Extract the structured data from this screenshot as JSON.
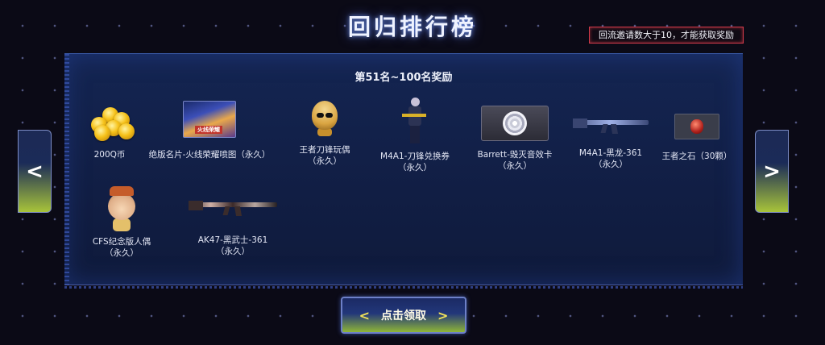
{
  "page": {
    "title": "回归排行榜",
    "notice": "回流邀请数大于10，才能获取奖励"
  },
  "panel": {
    "subtitle": "第51名~100名奖励",
    "rewards": [
      {
        "name": "200Q币",
        "duration": "",
        "icon": "coin-pile-icon"
      },
      {
        "name": "绝版名片-火线荣耀喷图（永久）",
        "duration": "",
        "icon": "spray-card-icon",
        "badge": "火线荣耀"
      },
      {
        "name": "王者刀锋玩偶",
        "duration": "（永久）",
        "icon": "doll-icon"
      },
      {
        "name": "M4A1-刀锋兑换券",
        "duration": "（永久）",
        "icon": "character-icon"
      },
      {
        "name": "Barrett-毁灭音效卡",
        "duration": "（永久）",
        "icon": "sound-card-icon"
      },
      {
        "name": "M4A1-黑龙-361",
        "duration": "（永久）",
        "icon": "rifle-icon"
      },
      {
        "name": "王者之石（30颗）",
        "duration": "",
        "icon": "king-stone-icon"
      },
      {
        "name": "CFS纪念版人偶",
        "duration": "（永久）",
        "icon": "figurine-icon"
      },
      {
        "name": "AK47-黑武士-361",
        "duration": "（永久）",
        "icon": "rifle-icon"
      }
    ]
  },
  "nav": {
    "prev": "<",
    "next": ">"
  },
  "claim_button": {
    "label": "点击领取",
    "left_arrow": "<",
    "right_arrow": ">"
  }
}
